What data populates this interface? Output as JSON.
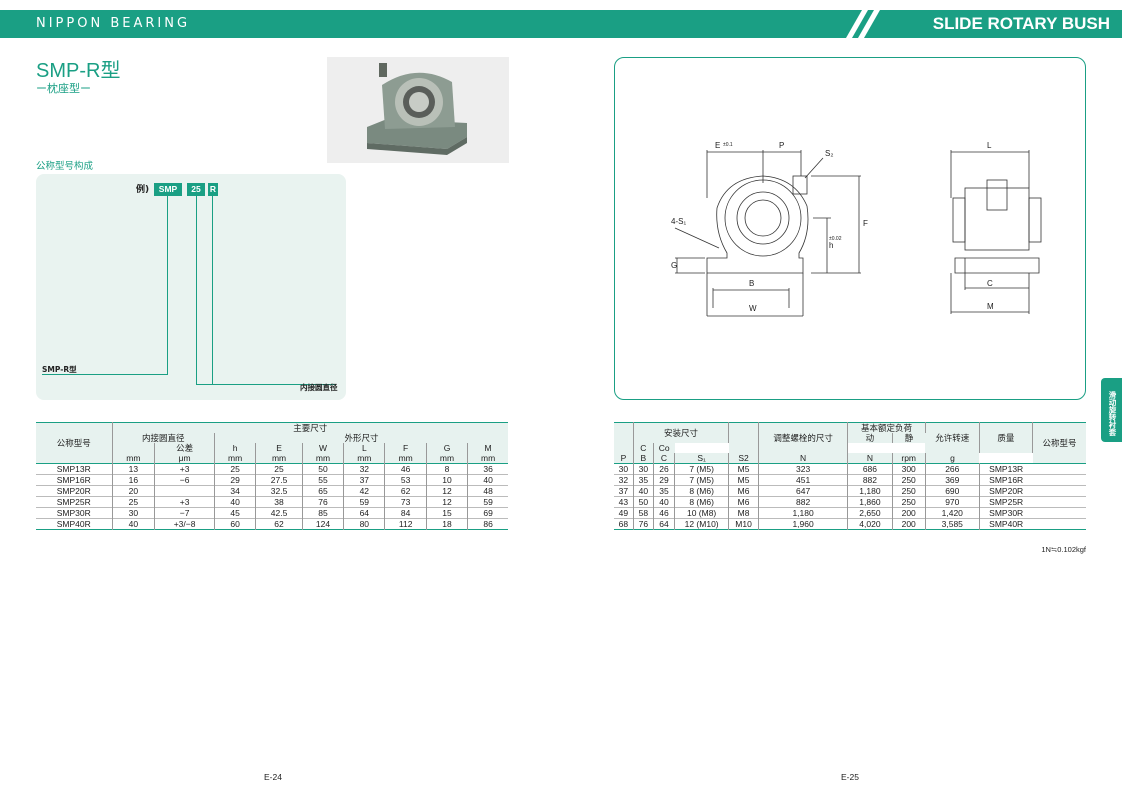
{
  "header": {
    "brand": "NIPPON BEARING",
    "title": "SLIDE ROTARY BUSH"
  },
  "product": {
    "title": "SMP-R型",
    "subtitle": "ー枕座型ー"
  },
  "code": {
    "section_title": "公称型号构成",
    "example_label": "例)",
    "parts": [
      "SMP",
      "25",
      "R"
    ],
    "label_type": "SMP-R型",
    "label_bore": "内接圆直径"
  },
  "drawing": {
    "labels": {
      "E": "E",
      "E_tol": "±0.1",
      "P": "P",
      "S2": "S₂",
      "S1": "4-S₁",
      "F": "F",
      "h": "h",
      "h_tol": "±0.02",
      "G": "G",
      "B": "B",
      "W": "W",
      "L": "L",
      "C": "C",
      "M": "M"
    }
  },
  "side_tab": "滑动旋转衬套",
  "left_table": {
    "h_model": "公称型号",
    "h_main": "主要尺寸",
    "h_bore": "内接圆直径",
    "h_tol": "公差",
    "h_outer": "外形尺寸",
    "cols": [
      "h",
      "E",
      "W",
      "L",
      "F",
      "G",
      "M"
    ],
    "units": [
      "mm",
      "μm",
      "mm",
      "mm",
      "mm",
      "mm",
      "mm",
      "mm",
      "mm"
    ],
    "rows": [
      [
        "SMP13R",
        "13",
        "+3",
        "25",
        "25",
        "50",
        "32",
        "46",
        "8",
        "36"
      ],
      [
        "SMP16R",
        "16",
        "−6",
        "29",
        "27.5",
        "55",
        "37",
        "53",
        "10",
        "40"
      ],
      [
        "SMP20R",
        "20",
        "",
        "34",
        "32.5",
        "65",
        "42",
        "62",
        "12",
        "48"
      ],
      [
        "SMP25R",
        "25",
        "+3",
        "40",
        "38",
        "76",
        "59",
        "73",
        "12",
        "59"
      ],
      [
        "SMP30R",
        "30",
        "−7",
        "45",
        "42.5",
        "85",
        "64",
        "84",
        "15",
        "69"
      ],
      [
        "SMP40R",
        "40",
        "+3/−8",
        "60",
        "62",
        "124",
        "80",
        "112",
        "18",
        "86"
      ]
    ]
  },
  "right_table": {
    "h_install": "安装尺寸",
    "h_adjust": "调整螺栓的尺寸",
    "h_load": "基本额定负荷",
    "h_dyn": "动",
    "h_static": "静",
    "h_speed": "允许转速",
    "h_mass": "质量",
    "h_model": "公称型号",
    "cols": [
      "P",
      "B",
      "C",
      "S₁",
      "S2",
      "C",
      "Co"
    ],
    "units": [
      "mm",
      "mm",
      "mm",
      "mm",
      "S2",
      "N",
      "N",
      "rpm",
      "g"
    ],
    "rows": [
      [
        "30",
        "30",
        "26",
        "7 (M5)",
        "M5",
        "323",
        "686",
        "300",
        "266",
        "SMP13R"
      ],
      [
        "32",
        "35",
        "29",
        "7 (M5)",
        "M5",
        "451",
        "882",
        "250",
        "369",
        "SMP16R"
      ],
      [
        "37",
        "40",
        "35",
        "8 (M6)",
        "M6",
        "647",
        "1,180",
        "250",
        "690",
        "SMP20R"
      ],
      [
        "43",
        "50",
        "40",
        "8 (M6)",
        "M6",
        "882",
        "1,860",
        "250",
        "970",
        "SMP25R"
      ],
      [
        "49",
        "58",
        "46",
        "10 (M8)",
        "M8",
        "1,180",
        "2,650",
        "200",
        "1,420",
        "SMP30R"
      ],
      [
        "68",
        "76",
        "64",
        "12 (M10)",
        "M10",
        "1,960",
        "4,020",
        "200",
        "3,585",
        "SMP40R"
      ]
    ],
    "note": "1N≒0.102kgf"
  },
  "pages": {
    "left": "E-24",
    "right": "E-25"
  },
  "colors": {
    "accent": "#1a9f84",
    "panel": "#e9f3f0"
  }
}
